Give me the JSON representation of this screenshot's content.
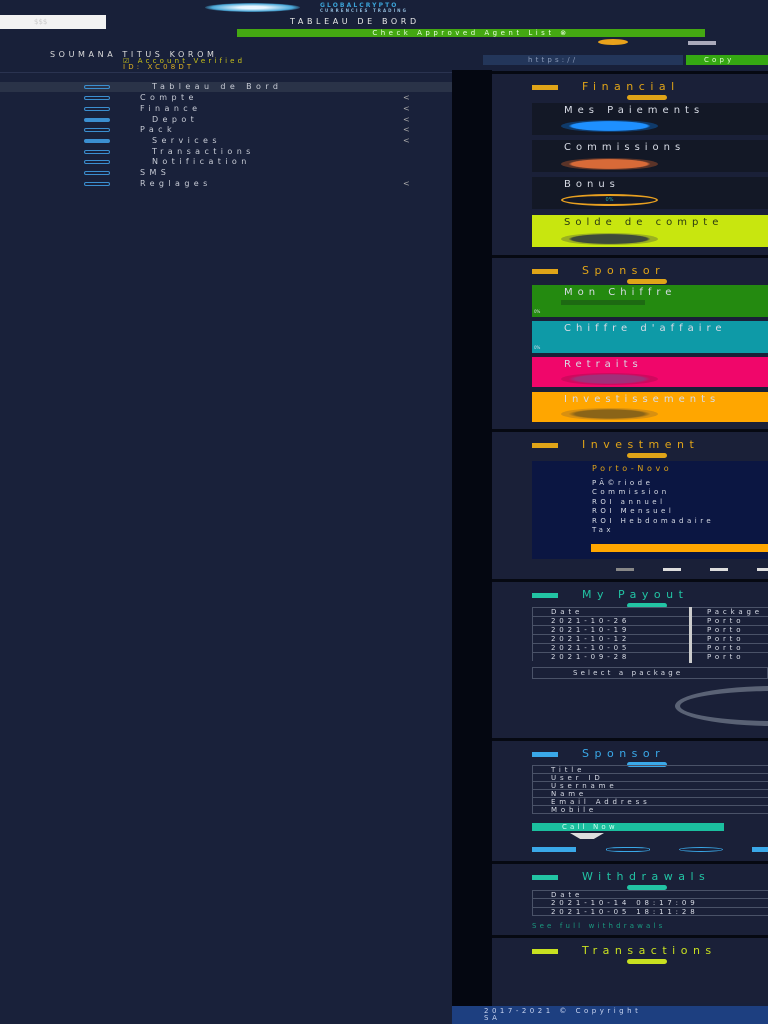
{
  "header": {
    "search_placeholder": "$$$",
    "brand_line1": "GLOBALCRYPTO",
    "brand_line2": "CURRENCIES TRADING",
    "page_title": "TABLEAU DE BORD",
    "agent_button": "Check Approved Agent List ⊗",
    "user_name": "SOUMANA TITUS KOROM",
    "verified": "☑ Account Verified",
    "user_id": "ID: XC08DT",
    "referral_url": "https://",
    "copy_button": "Copy"
  },
  "sidebar": {
    "items": [
      {
        "label": "Tableau de Bord",
        "chevron": ""
      },
      {
        "label": "Compte",
        "chevron": "<"
      },
      {
        "label": "Finance",
        "chevron": "<"
      },
      {
        "label": "Depot",
        "chevron": "<"
      },
      {
        "label": "Pack",
        "chevron": "<"
      },
      {
        "label": "Services",
        "chevron": "<"
      },
      {
        "label": "Transactions",
        "chevron": ""
      },
      {
        "label": "Notification",
        "chevron": ""
      },
      {
        "label": "SMS",
        "chevron": ""
      },
      {
        "label": "Reglages",
        "chevron": "<"
      }
    ]
  },
  "financial": {
    "title": "Financial",
    "items": [
      {
        "label": "Mes Paiements",
        "value": ""
      },
      {
        "label": "Commissions",
        "value": ""
      },
      {
        "label": "Bonus",
        "value": "0%"
      },
      {
        "label": "Solde de compte",
        "value": ""
      }
    ]
  },
  "sponsor_stats": {
    "title": "Sponsor",
    "items": [
      {
        "label": "Mon Chiffre",
        "percent": "0%"
      },
      {
        "label": "Chiffre d'affaire",
        "percent": "0%"
      },
      {
        "label": "Retraits"
      },
      {
        "label": "Investissements"
      }
    ]
  },
  "investment": {
    "title": "Investment",
    "plan": "Porto-Novo",
    "lines": [
      "PÃ©riode",
      "Commission",
      "ROI annuel",
      "ROI Mensuel",
      "ROI Hebdomadaire",
      "Tax"
    ]
  },
  "payout": {
    "title": "My Payout",
    "headers": [
      "Date",
      "Package"
    ],
    "rows": [
      [
        "2021-10-26",
        "Porto"
      ],
      [
        "2021-10-19",
        "Porto"
      ],
      [
        "2021-10-12",
        "Porto"
      ],
      [
        "2021-10-05",
        "Porto"
      ],
      [
        "2021-09-28",
        "Porto"
      ]
    ],
    "select_placeholder": "Select a package"
  },
  "sponsor_info": {
    "title": "Sponsor",
    "fields": [
      "Title",
      "User ID",
      "Username",
      "Name",
      "Email Address",
      "Mobile"
    ],
    "call_button": "Call Now"
  },
  "withdraw": {
    "title": "Withdrawals",
    "headers": [
      "Date"
    ],
    "rows": [
      "2021-10-14 08:17:09",
      "2021-10-05 18:11:28"
    ],
    "link": "See full withdrawals"
  },
  "transactions": {
    "title": "Transactions"
  },
  "footer": {
    "text": "2017-2021 © Copyright",
    "text2": "SA"
  }
}
